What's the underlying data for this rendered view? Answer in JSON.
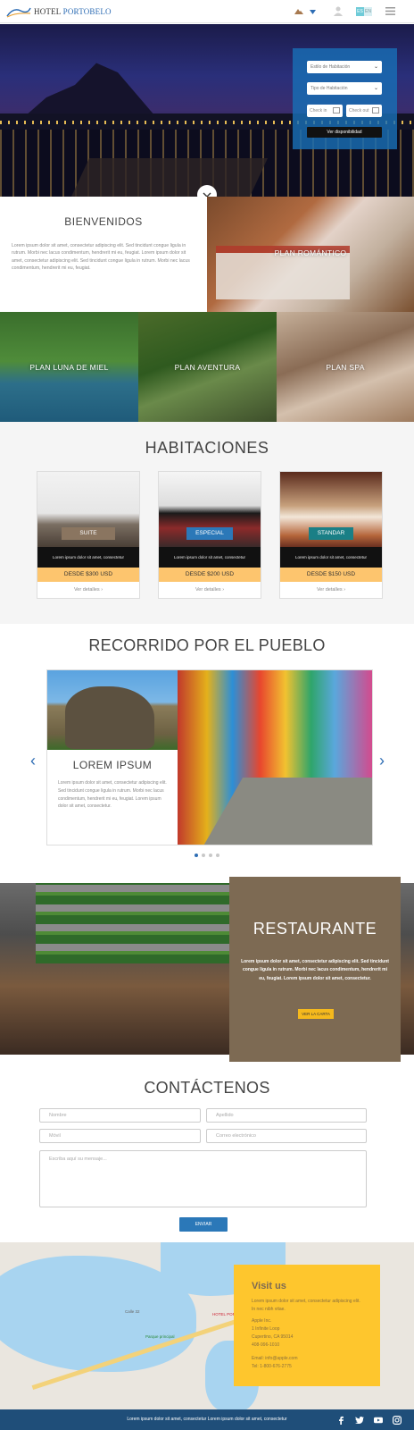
{
  "header": {
    "logo_text_1": "HOTEL",
    "logo_text_2": "PORTOBELO",
    "lang_es": "ES",
    "lang_en": "EN"
  },
  "booking": {
    "room_type": "Estilo de Habitación",
    "room_count": "Tipo de Habitación",
    "checkin": "Check in",
    "checkout": "Check out",
    "button": "Ver disponibilidad"
  },
  "welcome": {
    "title": "BIENVENIDOS",
    "text": "Lorem ipsum dolor sit amet, consectetur adipiscing elit. Sed tincidunt congue ligula in rutrum. Morbi nec lacus condimentum, hendrerit mi eu, feugiat. Lorem ipsum dolor sit amet, consectetur adipiscing elit. Sed tincidunt congue ligula in rutrum. Morbi nec lacus condimentum, hendrerit mi eu, feugiat."
  },
  "plans": {
    "romantico": "PLAN ROMÁNTICO",
    "luna": "PLAN LUNA DE MIEL",
    "aventura": "PLAN AVENTURA",
    "spa": "PLAN SPA"
  },
  "habitaciones": {
    "title": "HABITACIONES",
    "rooms": [
      {
        "badge": "SUITE",
        "desc": "Lorem ipsum dolor sit amet, consectetur",
        "price": "DESDE $300 USD",
        "more": "Ver detalles",
        "badge_color": "#8a7560"
      },
      {
        "badge": "ESPECIAL",
        "desc": "Lorem ipsum dolor sit amet, consectetur",
        "price": "DESDE $200 USD",
        "more": "Ver detalles",
        "badge_color": "#2b78b8"
      },
      {
        "badge": "STANDAR",
        "desc": "Lorem ipsum dolor sit amet, consectetur",
        "price": "DESDE $150 USD",
        "more": "Ver detalles",
        "badge_color": "#1a7f86"
      }
    ]
  },
  "recorrido": {
    "title": "RECORRIDO POR EL PUEBLO",
    "slide_title": "LOREM IPSUM",
    "slide_text": "Lorem ipsum dolor sit amet, consectetur adipiscing elit. Sed tincidunt congue ligula in rutrum. Morbi nec lacus condimentum, hendrerit mi eu, feugiat. Lorem ipsum dolor sit amet, consectetur.",
    "dots_active": 1,
    "dots_total": 4
  },
  "restaurante": {
    "title": "RESTAURANTE",
    "text": "Lorem ipsum dolor sit amet, consectetur adipiscing elit. Sed tincidunt congue ligula in rutrum. Morbi nec lacus condimentum, hendrerit mi eu, feugiat. Lorem ipsum dolor sit amet, consectetur.",
    "button": "VER LA CARTA"
  },
  "contact": {
    "title": "CONTÁCTENOS",
    "name_ph": "Nombre",
    "last_ph": "Apellido",
    "mobile_ph": "Móvil",
    "email_ph": "Correo electrónico",
    "message_ph": "Escriba aquí su mensaje...",
    "send": "ENVIAR"
  },
  "map": {
    "label_1": "Calle 32",
    "label_2": "Parque principal",
    "label_3": "HOTEL PORTOBELO"
  },
  "visit": {
    "title": "Visit us",
    "desc": "Lorem ipsum dolor sit amet, consectetur adipiscing elit. In nec nibh vitae.",
    "addr_1": "Apple Inc.",
    "addr_2": "1 Infinite Loop",
    "addr_3": "Cupertino, CA 95014",
    "addr_4": "408-996-1010",
    "email": "Email: info@apple.com",
    "tel": "Tel: 1-800-676-2775"
  },
  "footer": {
    "text": "Lorem ipsum dolor sit amet, consectetur Lorem ipsum dolor sit amet, consectetur"
  },
  "colors": {
    "brand_blue": "#2b78b8",
    "accent_yellow": "#fec62d",
    "resto_brown": "#7d6a53",
    "footer_blue": "#1f4e79"
  }
}
